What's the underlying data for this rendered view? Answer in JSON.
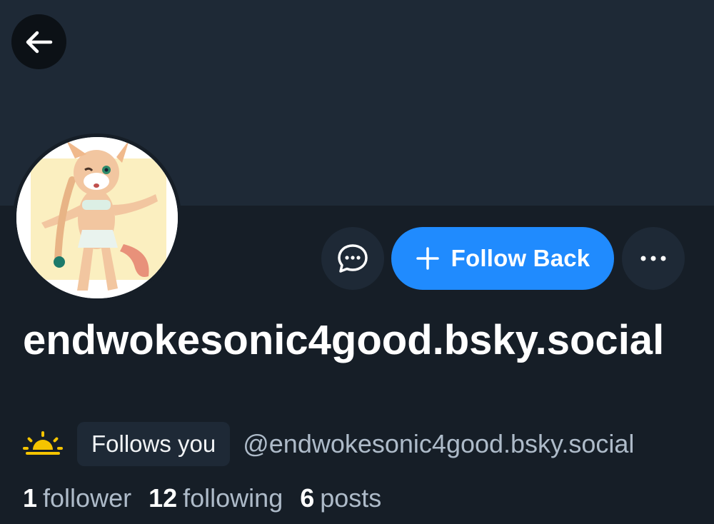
{
  "profile": {
    "display_name": "endwokesonic4good.bsky.social",
    "handle": "@endwokesonic4good.bsky.social",
    "follows_you_label": "Follows you"
  },
  "actions": {
    "follow_back_label": "Follow Back"
  },
  "stats": {
    "followers_count": "1",
    "followers_label": "follower",
    "following_count": "12",
    "following_label": "following",
    "posts_count": "6",
    "posts_label": "posts"
  },
  "icons": {
    "back": "arrow-left-icon",
    "message": "chat-bubble-icon",
    "follow": "plus-icon",
    "more": "ellipsis-icon",
    "status": "sunrise-icon"
  },
  "colors": {
    "background": "#161e27",
    "banner": "#1e2936",
    "accent": "#208bfe",
    "muted_text": "#aebbc9",
    "status_icon": "#f5c400"
  }
}
